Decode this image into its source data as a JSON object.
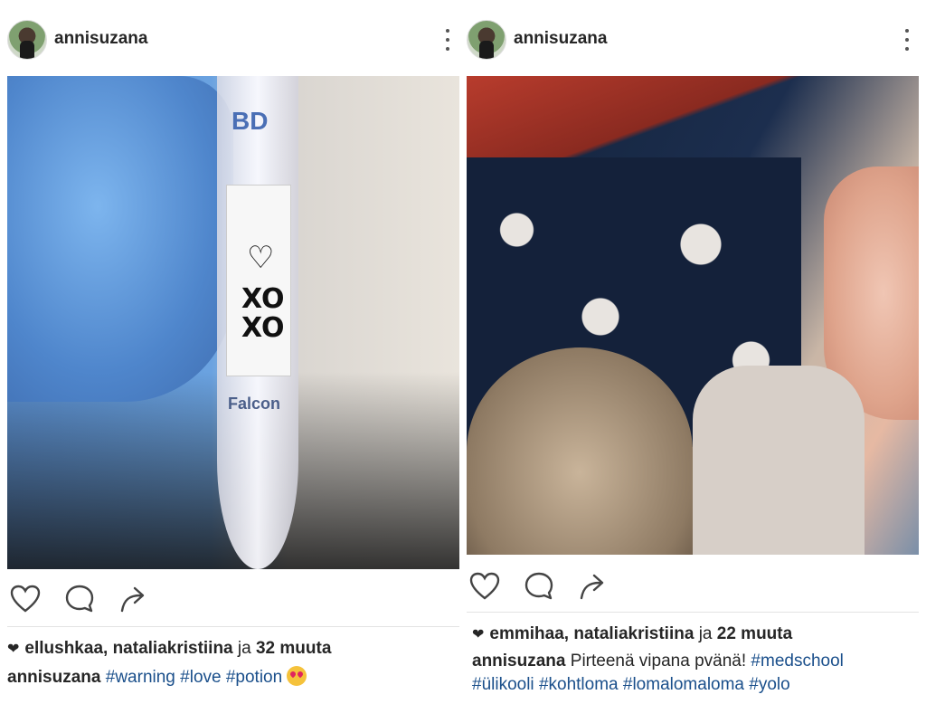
{
  "posts": [
    {
      "username": "annisuzana",
      "photo_text": {
        "brand_top": "BD",
        "heart": "♡",
        "xo_line1": "XO",
        "xo_line2": "XO",
        "brand_bottom": "Falcon"
      },
      "likes": {
        "names": "ellushkaa, nataliakristiina",
        "conjunction": "ja",
        "count_text": "32 muuta"
      },
      "caption": {
        "user": "annisuzana",
        "text": "",
        "tags": [
          "#warning",
          "#love",
          "#potion"
        ],
        "emoji": "heart-eyes-emoji"
      }
    },
    {
      "username": "annisuzana",
      "likes": {
        "names": "emmihaa, nataliakristiina",
        "conjunction": "ja",
        "count_text": "22 muuta"
      },
      "caption": {
        "user": "annisuzana",
        "text": "Pirteenä vipana pvänä!",
        "tags": [
          "#medschool",
          "#ülikooli",
          "#kohtloma",
          "#lomalomaloma",
          "#yolo"
        ]
      }
    }
  ],
  "icons": {
    "more": "more-vertical-icon",
    "like": "heart-outline-icon",
    "comment": "comment-bubble-icon",
    "share": "share-arrow-icon",
    "liked_mini": "heart-filled-icon"
  },
  "colors": {
    "text": "#262626",
    "hashtag": "#1a4f8b",
    "divider": "#e3e3e3"
  }
}
